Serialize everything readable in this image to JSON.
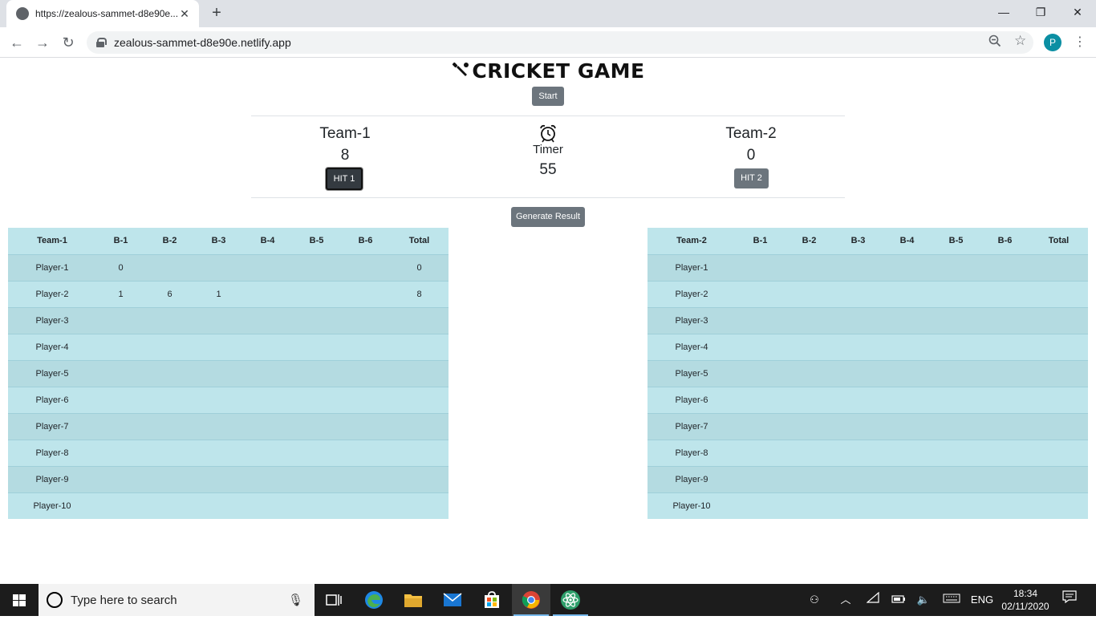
{
  "browser": {
    "tab_title": "https://zealous-sammet-d8e90e...",
    "new_tab_label": "+",
    "url": "zealous-sammet-d8e90e.netlify.app",
    "profile_initial": "P",
    "minimize": "—",
    "restore": "❐",
    "close": "✕"
  },
  "game": {
    "title": "CRICKET GAME",
    "start_label": "Start",
    "generate_label": "Generate Result",
    "timer_label": "Timer",
    "timer_value": "55",
    "team1": {
      "name": "Team-1",
      "score": "8",
      "hit_label": "HIT 1"
    },
    "team2": {
      "name": "Team-2",
      "score": "0",
      "hit_label": "HIT 2"
    }
  },
  "tables": {
    "columns": [
      "B-1",
      "B-2",
      "B-3",
      "B-4",
      "B-5",
      "B-6",
      "Total"
    ],
    "team1": {
      "header": "Team-1",
      "rows": [
        {
          "player": "Player-1",
          "balls": [
            "0",
            "",
            "",
            "",
            "",
            ""
          ],
          "total": "0"
        },
        {
          "player": "Player-2",
          "balls": [
            "1",
            "6",
            "1",
            "",
            "",
            ""
          ],
          "total": "8"
        },
        {
          "player": "Player-3",
          "balls": [
            "",
            "",
            "",
            "",
            "",
            ""
          ],
          "total": ""
        },
        {
          "player": "Player-4",
          "balls": [
            "",
            "",
            "",
            "",
            "",
            ""
          ],
          "total": ""
        },
        {
          "player": "Player-5",
          "balls": [
            "",
            "",
            "",
            "",
            "",
            ""
          ],
          "total": ""
        },
        {
          "player": "Player-6",
          "balls": [
            "",
            "",
            "",
            "",
            "",
            ""
          ],
          "total": ""
        },
        {
          "player": "Player-7",
          "balls": [
            "",
            "",
            "",
            "",
            "",
            ""
          ],
          "total": ""
        },
        {
          "player": "Player-8",
          "balls": [
            "",
            "",
            "",
            "",
            "",
            ""
          ],
          "total": ""
        },
        {
          "player": "Player-9",
          "balls": [
            "",
            "",
            "",
            "",
            "",
            ""
          ],
          "total": ""
        },
        {
          "player": "Player-10",
          "balls": [
            "",
            "",
            "",
            "",
            "",
            ""
          ],
          "total": ""
        }
      ]
    },
    "team2": {
      "header": "Team-2",
      "rows": [
        {
          "player": "Player-1",
          "balls": [
            "",
            "",
            "",
            "",
            "",
            ""
          ],
          "total": ""
        },
        {
          "player": "Player-2",
          "balls": [
            "",
            "",
            "",
            "",
            "",
            ""
          ],
          "total": ""
        },
        {
          "player": "Player-3",
          "balls": [
            "",
            "",
            "",
            "",
            "",
            ""
          ],
          "total": ""
        },
        {
          "player": "Player-4",
          "balls": [
            "",
            "",
            "",
            "",
            "",
            ""
          ],
          "total": ""
        },
        {
          "player": "Player-5",
          "balls": [
            "",
            "",
            "",
            "",
            "",
            ""
          ],
          "total": ""
        },
        {
          "player": "Player-6",
          "balls": [
            "",
            "",
            "",
            "",
            "",
            ""
          ],
          "total": ""
        },
        {
          "player": "Player-7",
          "balls": [
            "",
            "",
            "",
            "",
            "",
            ""
          ],
          "total": ""
        },
        {
          "player": "Player-8",
          "balls": [
            "",
            "",
            "",
            "",
            "",
            ""
          ],
          "total": ""
        },
        {
          "player": "Player-9",
          "balls": [
            "",
            "",
            "",
            "",
            "",
            ""
          ],
          "total": ""
        },
        {
          "player": "Player-10",
          "balls": [
            "",
            "",
            "",
            "",
            "",
            ""
          ],
          "total": ""
        }
      ]
    }
  },
  "taskbar": {
    "search_placeholder": "Type here to search",
    "apps": [
      "task-view-icon",
      "edge-icon",
      "file-explorer-icon",
      "mail-icon",
      "store-icon",
      "chrome-icon",
      "atom-icon"
    ],
    "language": "ENG",
    "time": "18:34",
    "date": "02/11/2020"
  },
  "colors": {
    "table_row_light": "#bee5eb",
    "table_row_dark": "#b4dbe1",
    "button_gray": "#6c757d",
    "button_dark": "#343a40",
    "profile": "#0b8fa3"
  }
}
